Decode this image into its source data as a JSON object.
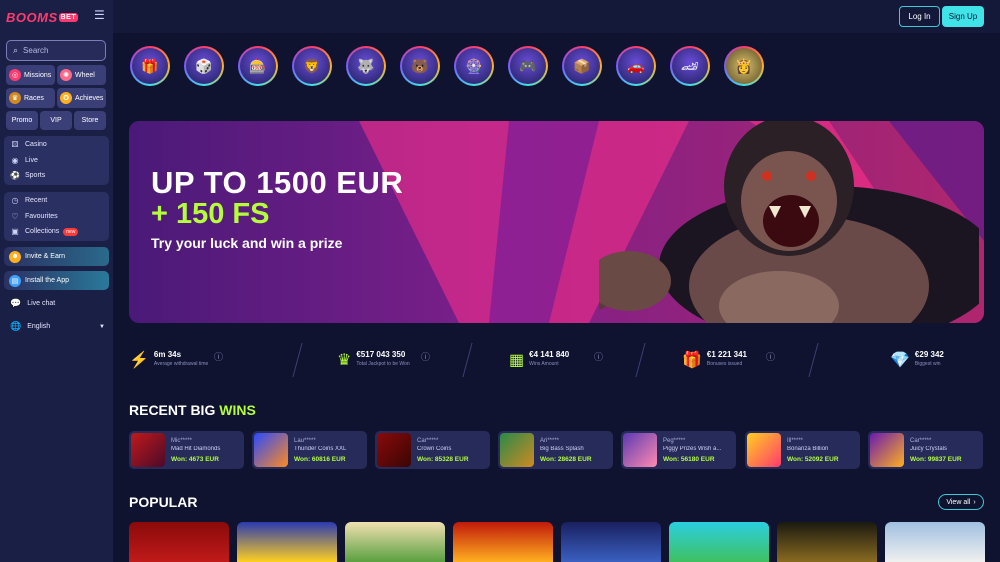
{
  "brand": {
    "name": "BOOMS",
    "suffix": "BET"
  },
  "header": {
    "login_label": "Log In",
    "signup_label": "Sign Up"
  },
  "sidebar": {
    "search_placeholder": "Search",
    "quick": [
      {
        "label": "Missions"
      },
      {
        "label": "Wheel"
      },
      {
        "label": "Races"
      },
      {
        "label": "Achieves"
      }
    ],
    "tabs": [
      {
        "label": "Promo"
      },
      {
        "label": "VIP"
      },
      {
        "label": "Store"
      }
    ],
    "main_nav": [
      {
        "label": "Casino"
      },
      {
        "label": "Live"
      },
      {
        "label": "Sports"
      }
    ],
    "user_nav": [
      {
        "label": "Recent"
      },
      {
        "label": "Favourites"
      },
      {
        "label": "Collections",
        "badge": "new"
      }
    ],
    "invite_label": "Invite & Earn",
    "install_label": "Install the App",
    "live_chat": "Live chat",
    "language": "English"
  },
  "banner": {
    "line1": "UP TO 1500 EUR",
    "line2": "+ 150 FS",
    "line3": "Try your luck and win a prize"
  },
  "stats": [
    {
      "value": "6m 34s",
      "label": "Average withdrawal time",
      "icon": "lightning-icon"
    },
    {
      "value": "€517 043 350",
      "label": "Total Jackpot to be Won",
      "icon": "crown-icon"
    },
    {
      "value": "€4 141 840",
      "label": "Wins Amount",
      "icon": "chest-icon"
    },
    {
      "value": "€1 221 341",
      "label": "Bonuses issued",
      "icon": "gift-icon"
    },
    {
      "value": "€29 342",
      "label": "Biggest win",
      "icon": "diamond-icon"
    }
  ],
  "recent_wins": {
    "title": "RECENT BIG",
    "title_highlight": "WINS",
    "items": [
      {
        "user": "Mic*****",
        "game": "Mad Hit Diamonds",
        "win": "Won: 4673 EUR"
      },
      {
        "user": "Lau*****",
        "game": "Thunder Coins XXL",
        "win": "Won: 60816 EUR"
      },
      {
        "user": "Car*****",
        "game": "Crown Coins",
        "win": "Won: 85328 EUR"
      },
      {
        "user": "Ari*****",
        "game": "Big Bass Splash",
        "win": "Won: 28628 EUR"
      },
      {
        "user": "Peg*****",
        "game": "Piggy Prizes Wish a...",
        "win": "Won: 56180 EUR"
      },
      {
        "user": "Ill*****",
        "game": "Bonanza Billion",
        "win": "Won: 52092 EUR"
      },
      {
        "user": "Car*****",
        "game": "Juicy Crystals",
        "win": "Won: 99837 EUR"
      }
    ]
  },
  "popular": {
    "title": "POPULAR",
    "view_all": "View all"
  }
}
